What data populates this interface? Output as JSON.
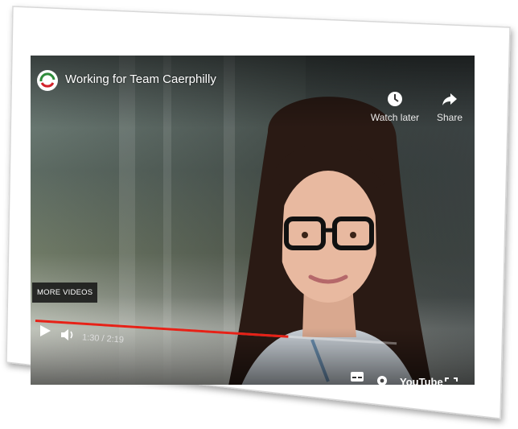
{
  "player": {
    "title": "Working for Team Caerphilly",
    "watch_later_label": "Watch later",
    "share_label": "Share",
    "more_videos_label": "MORE VIDEOS",
    "time": "1:30 / 2:19",
    "brand": "YouTube",
    "progress": 0.7
  },
  "colors": {
    "progress": "#e62117",
    "logo_green": "#2e8b3a",
    "logo_red": "#d2232a"
  },
  "icons": [
    "channel-logo",
    "clock-icon",
    "share-icon",
    "play-icon",
    "volume-icon",
    "subtitles-icon",
    "settings-icon",
    "fullscreen-icon"
  ]
}
